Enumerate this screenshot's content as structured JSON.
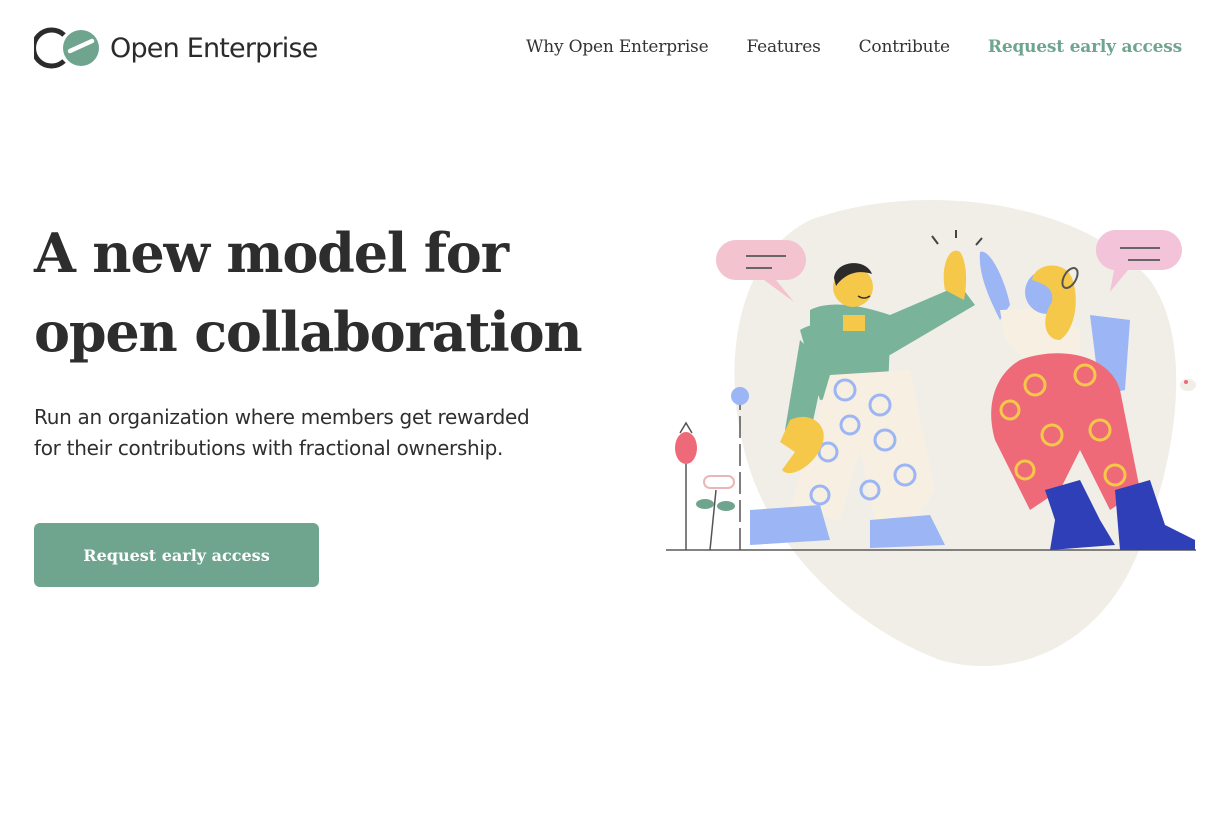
{
  "brand": {
    "name": "Open Enterprise",
    "accent_color": "#6fa58f",
    "logo_icon": "oe-monogram-icon"
  },
  "nav": {
    "items": [
      {
        "label": "Why Open Enterprise"
      },
      {
        "label": "Features"
      },
      {
        "label": "Contribute"
      },
      {
        "label": "Request early access"
      }
    ]
  },
  "hero": {
    "title_line1": "A new model for",
    "title_line2": "open collaboration",
    "subtitle_line1": "Run an organization where members get rewarded",
    "subtitle_line2": "for their contributions with fractional ownership.",
    "cta_label": "Request early access",
    "illustration": "high-five-illustration"
  }
}
